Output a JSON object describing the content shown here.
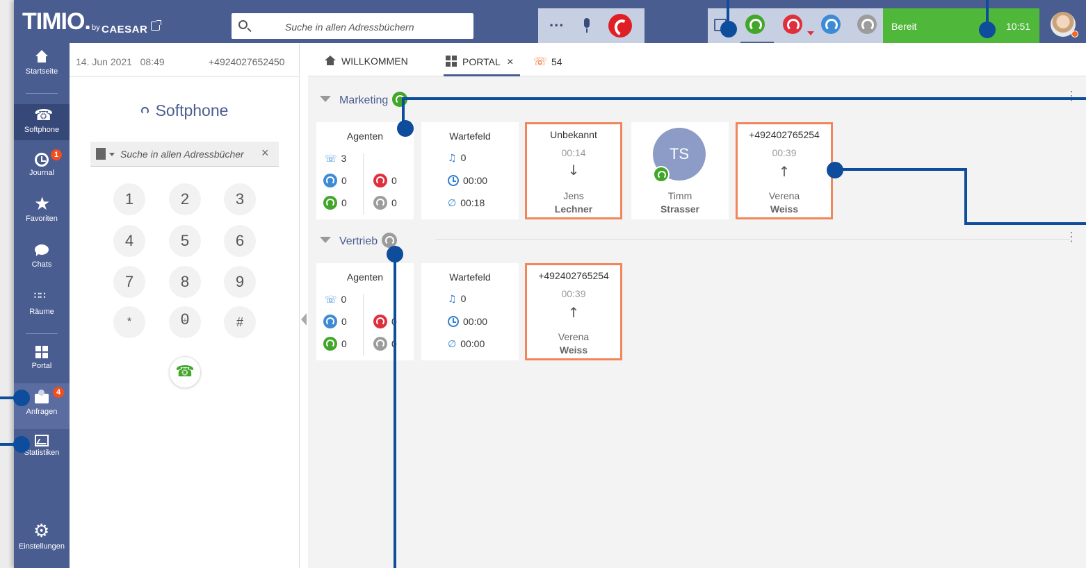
{
  "header": {
    "logo": "TIMIO.",
    "logo_by": "by",
    "logo_brand": "CAESAR",
    "search_placeholder": "Suche in allen Adressbüchern",
    "more_label": "...",
    "status_text": "Bereit",
    "time": "10:51"
  },
  "sidebar": {
    "items": [
      {
        "label": "Startseite",
        "icon": "home-icon"
      },
      {
        "label": "Softphone",
        "icon": "phone-icon"
      },
      {
        "label": "Journal",
        "icon": "clock-icon",
        "badge": "1"
      },
      {
        "label": "Favoriten",
        "icon": "star-icon"
      },
      {
        "label": "Chats",
        "icon": "chat-icon"
      },
      {
        "label": "Räume",
        "icon": "rooms-icon"
      },
      {
        "label": "Portal",
        "icon": "grid-icon"
      },
      {
        "label": "Anfragen",
        "icon": "mail-icon",
        "badge": "4"
      },
      {
        "label": "Statistiken",
        "icon": "stats-icon"
      },
      {
        "label": "Einstellungen",
        "icon": "gear-icon"
      }
    ]
  },
  "softphone": {
    "date": "14. Jun 2021",
    "time": "08:49",
    "number": "+4924027652450",
    "title": "Softphone",
    "search_placeholder": "Suche in allen Adressbücher",
    "keys": [
      "1",
      "2",
      "3",
      "4",
      "5",
      "6",
      "7",
      "8",
      "9",
      "*",
      "0",
      "#"
    ],
    "zero_sub": "+"
  },
  "tabs": {
    "welcome": "WILLKOMMEN",
    "portal": "PORTAL",
    "close": "×",
    "missed_count": "54"
  },
  "groups": [
    {
      "name": "Marketing",
      "status_color": "#41a62a",
      "agents": {
        "title": "Agenten",
        "calls": "3",
        "blue": "0",
        "red": "0",
        "green": "0",
        "grey": "0"
      },
      "queue": {
        "title": "Wartefeld",
        "waiting": "0",
        "time": "00:00",
        "avg": "00:18"
      },
      "calls": [
        {
          "caller": "Unbekannt",
          "duration": "00:14",
          "direction": "in",
          "first": "Jens",
          "last": "Lechner"
        },
        {
          "caller": "+492402765254",
          "duration": "00:39",
          "direction": "out",
          "first": "Verena",
          "last": "Weiss"
        }
      ],
      "agent_card": {
        "initials": "TS",
        "first": "Timm",
        "last": "Strasser"
      }
    },
    {
      "name": "Vertrieb",
      "status_color": "#9c9c9c",
      "agents": {
        "title": "Agenten",
        "calls": "0",
        "blue": "0",
        "red": "0",
        "green": "0",
        "grey": "0"
      },
      "queue": {
        "title": "Wartefeld",
        "waiting": "0",
        "time": "00:00",
        "avg": "00:00"
      },
      "calls": [
        {
          "caller": "+492402765254",
          "duration": "00:39",
          "direction": "out",
          "first": "Verena",
          "last": "Weiss"
        }
      ]
    }
  ],
  "colors": {
    "header_bg": "#4a5d91",
    "ready_green": "#4fb73a",
    "accent_orange": "#f0865a",
    "annotation_blue": "#0d4d9b"
  }
}
